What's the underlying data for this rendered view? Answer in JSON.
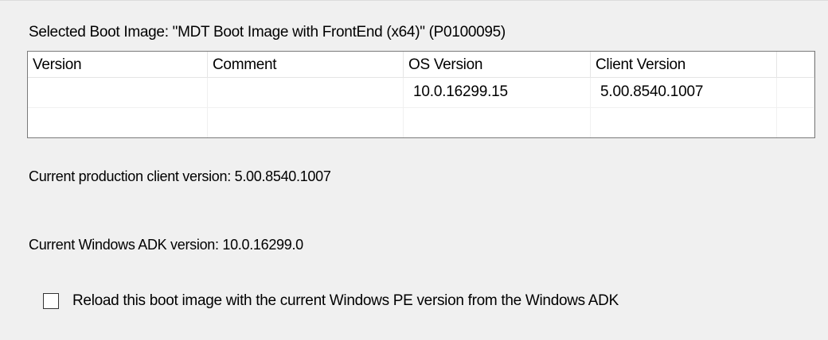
{
  "selected_boot_image": {
    "label": "Selected Boot Image: \"MDT Boot Image with FrontEnd (x64)\" (P0100095)"
  },
  "table": {
    "columns": [
      "Version",
      "Comment",
      "OS Version",
      "Client Version",
      ""
    ],
    "rows": [
      [
        "",
        "",
        "10.0.16299.15",
        "5.00.8540.1007",
        ""
      ],
      [
        "",
        "",
        "",
        "",
        ""
      ]
    ]
  },
  "info": {
    "production_client": "Current production client version: 5.00.8540.1007",
    "adk_version": "Current Windows ADK version: 10.0.16299.0"
  },
  "reload_option": {
    "label": "Reload this boot image with the current Windows PE version from the Windows ADK",
    "checked": false
  }
}
